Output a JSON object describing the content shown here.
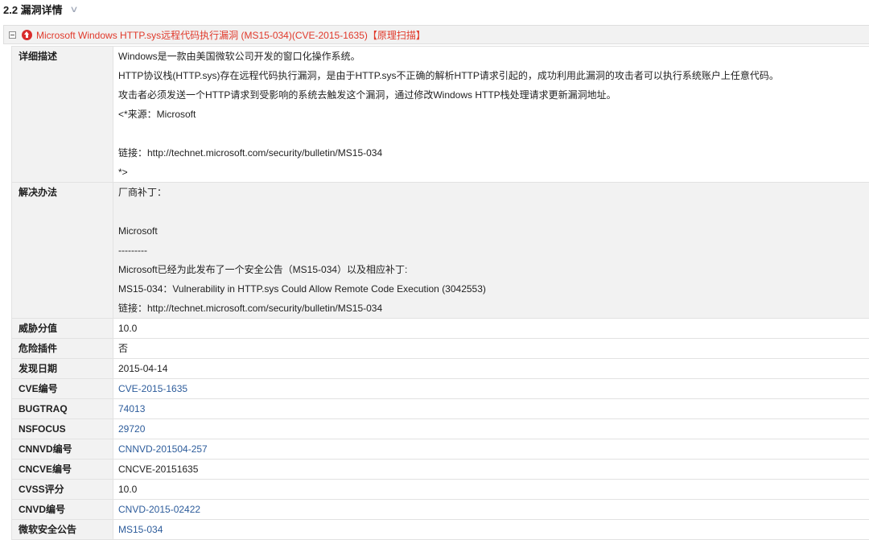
{
  "section": {
    "title": "2.2 漏洞详情"
  },
  "vuln": {
    "title": "Microsoft Windows HTTP.sys远程代码执行漏洞 (MS15-034)(CVE-2015-1635)",
    "tag": "【原理扫描】"
  },
  "description": {
    "label": "详细描述",
    "lines": [
      "Windows是一款由美国微软公司开发的窗口化操作系统。",
      "HTTP协议栈(HTTP.sys)存在远程代码执行漏洞，是由于HTTP.sys不正确的解析HTTP请求引起的，成功利用此漏洞的攻击者可以执行系统账户上任意代码。",
      "攻击者必须发送一个HTTP请求到受影响的系统去触发这个漏洞，通过修改Windows HTTP栈处理请求更新漏洞地址。",
      "<*来源：Microsoft",
      "",
      "链接：http://technet.microsoft.com/security/bulletin/MS15-034",
      "*>"
    ]
  },
  "solution": {
    "label": "解决办法",
    "lines": [
      "厂商补丁：",
      "",
      "Microsoft",
      "---------",
      "Microsoft已经为此发布了一个安全公告（MS15-034）以及相应补丁:",
      "MS15-034：Vulnerability in HTTP.sys Could Allow Remote Code Execution (3042553)",
      "链接：http://technet.microsoft.com/security/bulletin/MS15-034"
    ]
  },
  "fields": [
    {
      "label": "威胁分值",
      "value": "10.0",
      "link": false
    },
    {
      "label": "危险插件",
      "value": "否",
      "link": false
    },
    {
      "label": "发现日期",
      "value": "2015-04-14",
      "link": false
    },
    {
      "label": "CVE编号",
      "value": "CVE-2015-1635",
      "link": true
    },
    {
      "label": "BUGTRAQ",
      "value": "74013",
      "link": true
    },
    {
      "label": "NSFOCUS",
      "value": "29720",
      "link": true
    },
    {
      "label": "CNNVD编号",
      "value": "CNNVD-201504-257",
      "link": true
    },
    {
      "label": "CNCVE编号",
      "value": "CNCVE-20151635",
      "link": false
    },
    {
      "label": "CVSS评分",
      "value": "10.0",
      "link": false
    },
    {
      "label": "CNVD编号",
      "value": "CNVD-2015-02422",
      "link": true
    },
    {
      "label": "微软安全公告",
      "value": "MS15-034",
      "link": true
    }
  ],
  "colors": {
    "alert": "#d82c2c",
    "title_red": "#e0392b",
    "link_blue": "#2d5c9b",
    "label_bg": "#f2f2f2"
  }
}
